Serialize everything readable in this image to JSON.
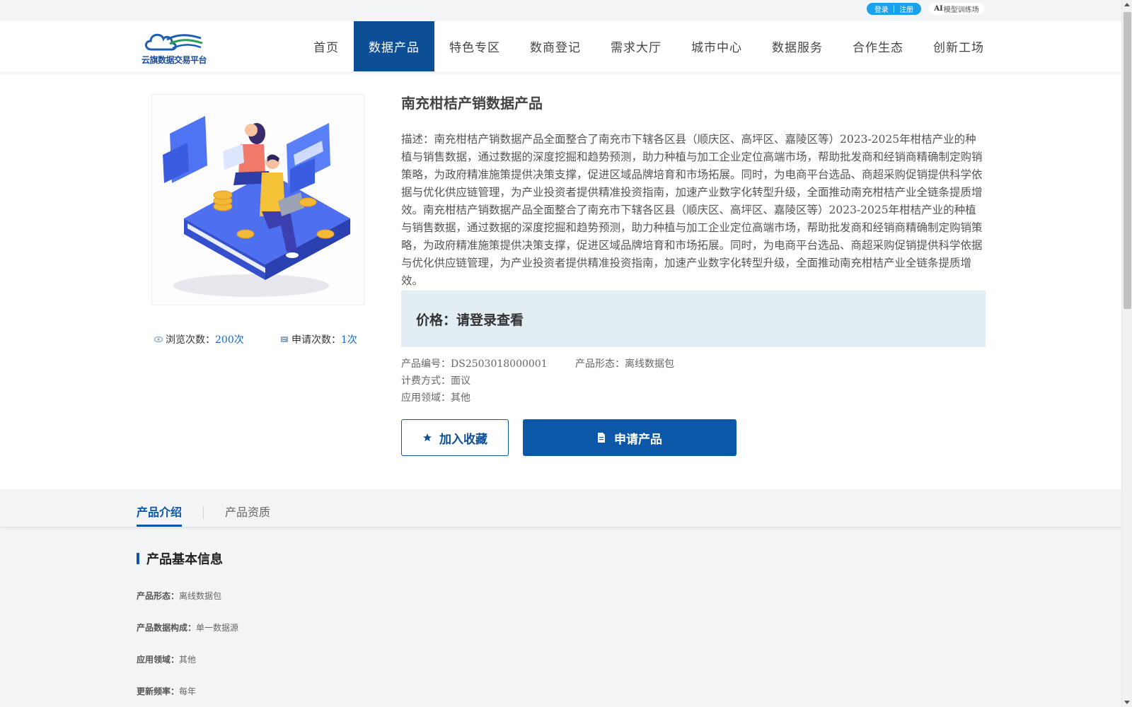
{
  "topbar": {
    "login_label": "登录",
    "separator": "|",
    "register_label": "注册",
    "ai_prefix": "AI",
    "ai_label": "模型训练场"
  },
  "header": {
    "logo_text": "云旗数据交易平台",
    "nav": [
      {
        "label": "首页",
        "active": false
      },
      {
        "label": "数据产品",
        "active": true
      },
      {
        "label": "特色专区",
        "active": false
      },
      {
        "label": "数商登记",
        "active": false
      },
      {
        "label": "需求大厅",
        "active": false
      },
      {
        "label": "城市中心",
        "active": false
      },
      {
        "label": "数据服务",
        "active": false
      },
      {
        "label": "合作生态",
        "active": false
      },
      {
        "label": "创新工场",
        "active": false
      }
    ]
  },
  "product": {
    "title": "南充柑桔产销数据产品",
    "description": "描述：南充柑桔产销数据产品全面整合了南充市下辖各区县（顺庆区、高坪区、嘉陵区等）2023-2025年柑桔产业的种植与销售数据，通过数据的深度挖掘和趋势预测，助力种植与加工企业定位高端市场，帮助批发商和经销商精确制定购销策略，为政府精准施策提供决策支撑，促进区域品牌培育和市场拓展。同时，为电商平台选品、商超采购促销提供科学依据与优化供应链管理，为产业投资者提供精准投资指南，加速产业数字化转型升级，全面推动南充柑桔产业全链条提质增效。南充柑桔产销数据产品全面整合了南充市下辖各区县（顺庆区、高坪区、嘉陵区等）2023-2025年柑桔产业的种植与销售数据，通过数据的深度挖掘和趋势预测，助力种植与加工企业定位高端市场，帮助批发商和经销商精确制定购销策略，为政府精准施策提供决策支撑，促进区域品牌培育和市场拓展。同时，为电商平台选品、商超采购促销提供科学依据与优化供应链管理，为产业投资者提供精准投资指南，加速产业数字化转型升级，全面推动南充柑桔产业全链条提质增效。",
    "price": "价格：请登录查看",
    "views_label": "浏览次数：",
    "views_value": "200次",
    "applies_label": "申请次数：",
    "applies_value": "1次",
    "code_label": "产品编号：",
    "code_value": "DS2503018000001",
    "form_label": "产品形态：",
    "form_value": "离线数据包",
    "billing_label": "计费方式：",
    "billing_value": "面议",
    "domain_label": "应用领域：",
    "domain_value": "其他",
    "fav_button": "加入收藏",
    "apply_button": "申请产品"
  },
  "tabs": [
    {
      "label": "产品介绍",
      "active": true
    },
    {
      "label": "产品资质",
      "active": false
    }
  ],
  "basic_info": {
    "title": "产品基本信息",
    "rows": [
      {
        "key": "产品形态：",
        "value": "离线数据包"
      },
      {
        "key": "产品数据构成：",
        "value": "单一数据源"
      },
      {
        "key": "应用领域：",
        "value": "其他"
      },
      {
        "key": "更新频率：",
        "value": "每年"
      }
    ]
  },
  "colors": {
    "primary": "#0d57a8",
    "nav_active": "#0d4f96",
    "login_pill": "#1aa1ec",
    "price_bg": "#e3edf4",
    "lower_bg": "#f3f4f6"
  }
}
